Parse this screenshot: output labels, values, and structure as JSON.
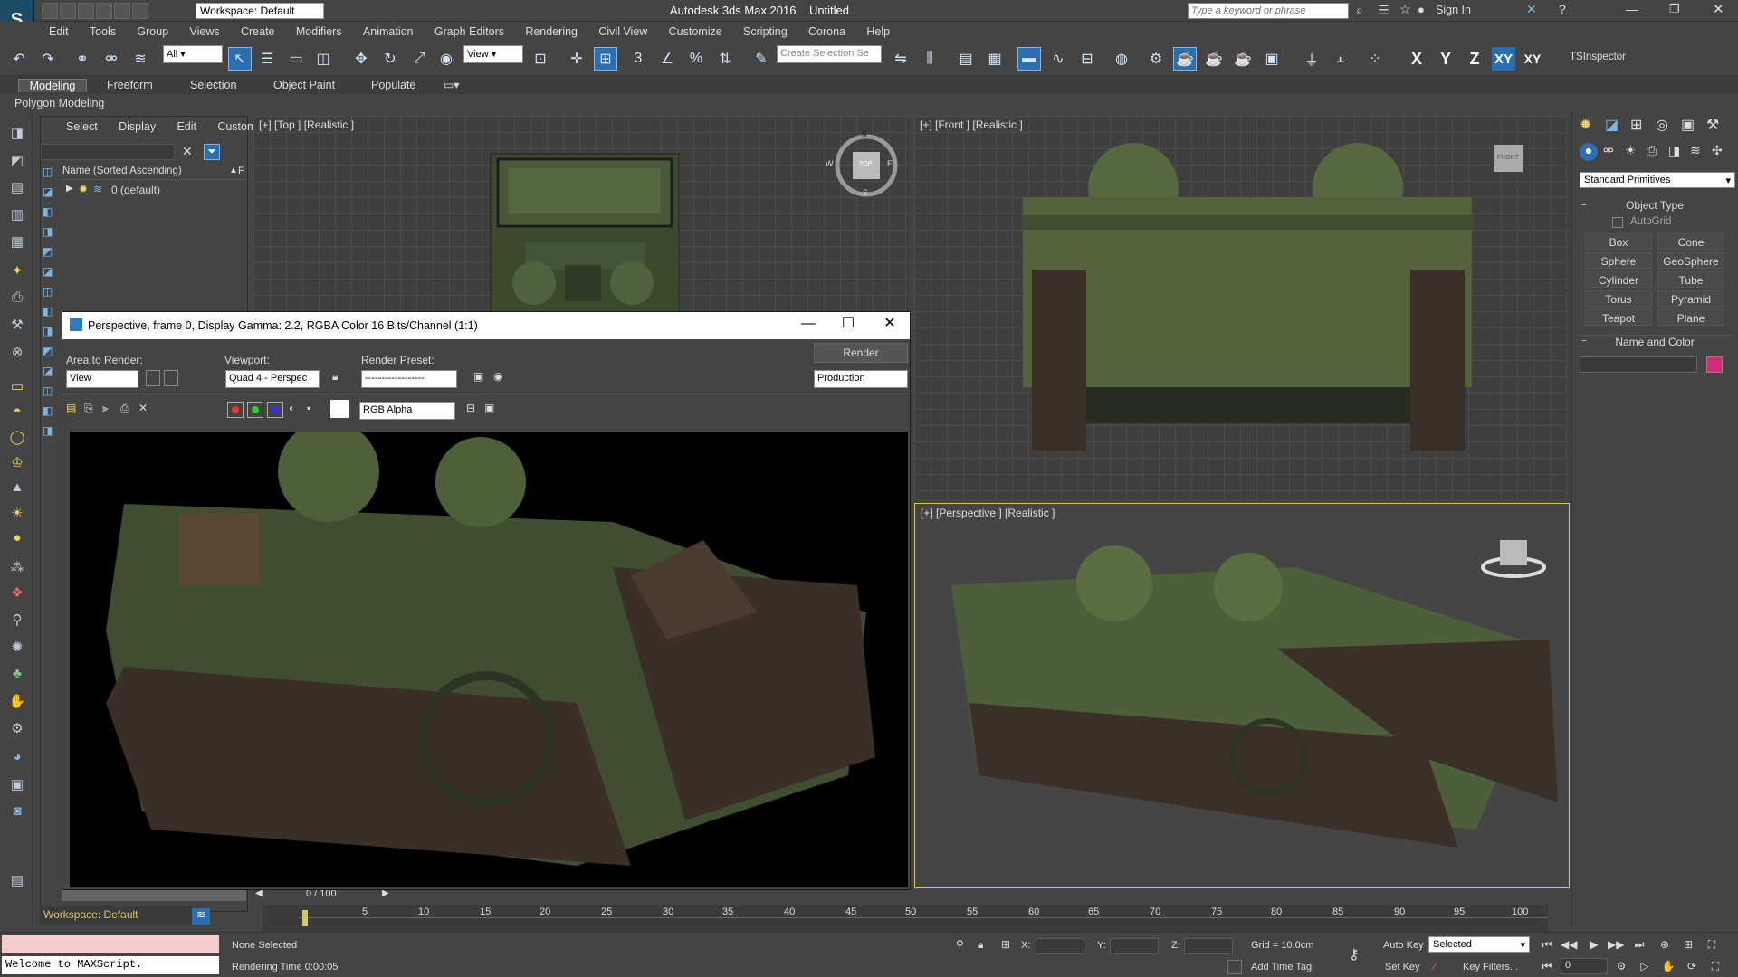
{
  "titlebar": {
    "workspace": "Workspace: Default",
    "app_title": "Autodesk 3ds Max 2016",
    "doc_title": "Untitled",
    "search_placeholder": "Type a keyword or phrase",
    "sign_in": "Sign In"
  },
  "menubar": {
    "items": [
      "Edit",
      "Tools",
      "Group",
      "Views",
      "Create",
      "Modifiers",
      "Animation",
      "Graph Editors",
      "Rendering",
      "Civil View",
      "Customize",
      "Scripting",
      "Corona",
      "Help"
    ]
  },
  "toolbar": {
    "filter_value": "All",
    "refcoord_value": "View",
    "selection_set_placeholder": "Create Selection Se",
    "axis_x": "X",
    "axis_y": "Y",
    "axis_z": "Z",
    "axis_xy": "XY",
    "axis_xy2": "XY",
    "tsinspector": "TSInspector"
  },
  "ribbon": {
    "tabs": [
      "Modeling",
      "Freeform",
      "Selection",
      "Object Paint",
      "Populate"
    ],
    "active_tab": "Modeling",
    "subtitle": "Polygon Modeling"
  },
  "explorer": {
    "menu": [
      "Select",
      "Display",
      "Edit",
      "Customize"
    ],
    "column_header": "Name (Sorted Ascending)",
    "column_header2": "F",
    "layer_name": "0 (default)"
  },
  "viewports": {
    "top_label": "[+] [Top ] [Realistic ]",
    "front_label": "[+] [Front ] [Realistic ]",
    "perspective_label": "[+] [Perspective ] [Realistic ]",
    "viewcube_top": "TOP",
    "viewcube_front": "FRONT",
    "compass_n": "N",
    "compass_s": "S",
    "compass_e": "E",
    "compass_w": "W"
  },
  "render_window": {
    "title": "Perspective, frame 0, Display Gamma: 2.2, RGBA Color 16 Bits/Channel (1:1)",
    "area_label": "Area to Render:",
    "area_value": "View",
    "viewport_label": "Viewport:",
    "viewport_value": "Quad 4 - Perspec",
    "preset_label": "Render Preset:",
    "preset_value": "------------------",
    "render_button": "Render",
    "production_value": "Production",
    "channel_value": "RGB Alpha"
  },
  "command_panel": {
    "category": "Standard Primitives",
    "object_type_header": "Object Type",
    "autogrid": "AutoGrid",
    "buttons": [
      "Box",
      "Cone",
      "Sphere",
      "GeoSphere",
      "Cylinder",
      "Tube",
      "Torus",
      "Pyramid",
      "Teapot",
      "Plane"
    ],
    "name_color_header": "Name and Color",
    "swatch_color": "#d8287a"
  },
  "timeline": {
    "frame_counter": "0 / 100",
    "ticks": [
      "5",
      "10",
      "15",
      "20",
      "25",
      "30",
      "35",
      "40",
      "45",
      "50",
      "55",
      "60",
      "65",
      "70",
      "75",
      "80",
      "85",
      "90",
      "95",
      "100"
    ],
    "workspace": "Workspace: Default"
  },
  "statusbar": {
    "maxscript_output": "Welcome to MAXScript.",
    "selection_status": "None Selected",
    "render_time": "Rendering Time  0:00:05",
    "x_label": "X:",
    "y_label": "Y:",
    "z_label": "Z:",
    "grid": "Grid = 10.0cm",
    "add_time_tag": "Add Time Tag",
    "auto_key": "Auto Key",
    "set_key": "Set Key",
    "selected_value": "Selected",
    "key_filters": "Key Filters...",
    "frame_value": "0"
  }
}
